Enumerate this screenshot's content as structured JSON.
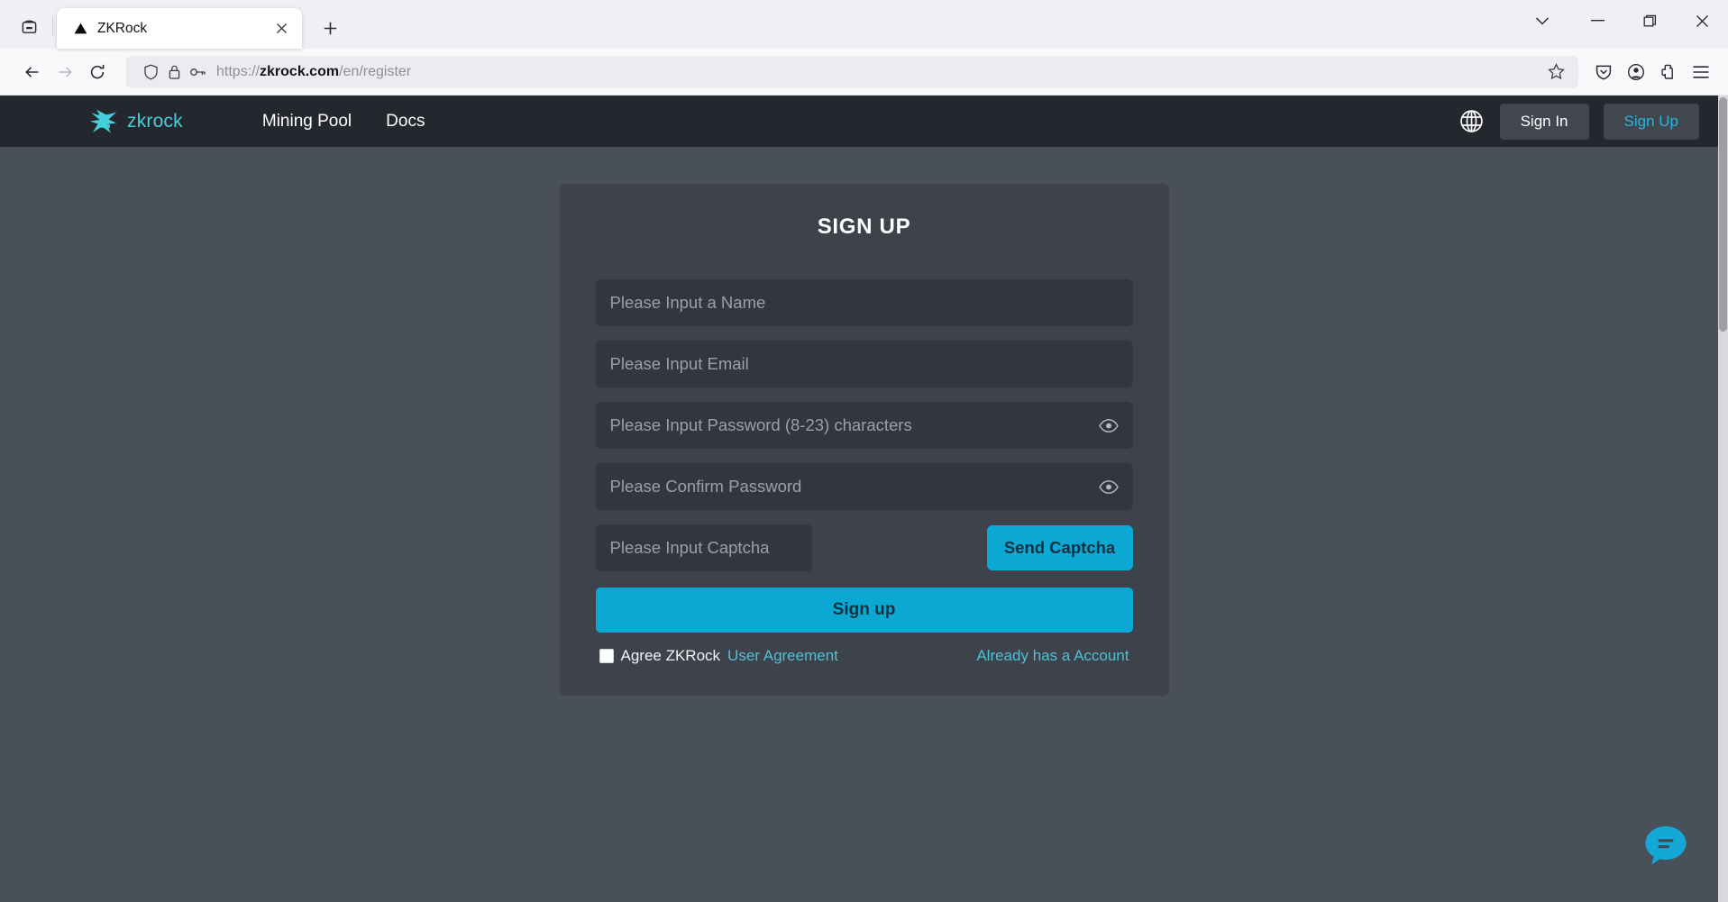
{
  "browser": {
    "tab": {
      "title": "ZKRock",
      "favicon": "triangle-favicon",
      "close_label": "✕"
    },
    "new_tab_label": "+",
    "window_controls": {
      "list_all_tabs": "⌄",
      "minimize": "–",
      "maximize": "❐",
      "close": "✕"
    },
    "toolbar": {
      "back": "back-arrow",
      "forward": "forward-arrow",
      "reload": "reload-arrow",
      "url_scheme": "https://",
      "url_host": "zkrock.com",
      "url_path": "/en/register",
      "url_full": "https://zkrock.com/en/register",
      "shield": "shield-icon",
      "lock": "lock-icon",
      "key": "key-icon",
      "bookmark": "star-icon",
      "pocket": "save-to-pocket-icon",
      "account": "account-icon",
      "extensions": "extensions-icon",
      "menu": "hamburger-menu-icon"
    }
  },
  "site": {
    "brand": {
      "name": "zkrock",
      "mark_color": "#45cfdb"
    },
    "nav_links": [
      {
        "label": "Mining Pool"
      },
      {
        "label": "Docs"
      }
    ],
    "language_icon": "globe-icon",
    "sign_in_label": "Sign In",
    "sign_up_label": "Sign Up"
  },
  "signup_form": {
    "title": "SIGN UP",
    "fields": [
      {
        "name": "name",
        "placeholder": "Please Input a Name",
        "value": "",
        "has_eye": false
      },
      {
        "name": "email",
        "placeholder": "Please Input Email",
        "value": "",
        "has_eye": false
      },
      {
        "name": "password",
        "placeholder": "Please Input Password (8-23) characters",
        "value": "",
        "has_eye": true
      },
      {
        "name": "confirm_password",
        "placeholder": "Please Confirm Password",
        "value": "",
        "has_eye": true
      }
    ],
    "captcha": {
      "placeholder": "Please Input Captcha",
      "value": "",
      "send_button_label": "Send Captcha"
    },
    "submit_label": "Sign up",
    "agreement": {
      "checked": false,
      "prefix": "Agree ZKRock",
      "link_label": "User Agreement"
    },
    "already_account_label": "Already has a Account"
  },
  "chat_widget": {
    "icon": "chat-bubble-icon",
    "color": "#14a8d6"
  },
  "colors": {
    "page_bg": "#4a505a",
    "header_bg": "#24272e",
    "card_bg": "#3e424b",
    "input_bg": "#32363f",
    "accent": "#0aa8d2",
    "link": "#4fc0d6",
    "brand": "#45cfdb"
  }
}
